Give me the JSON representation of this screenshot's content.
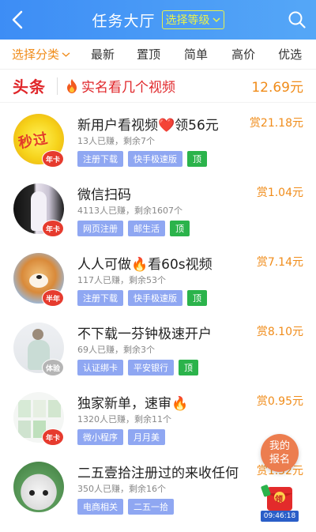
{
  "header": {
    "title": "任务大厅",
    "level_label": "选择等级"
  },
  "filters": [
    "选择分类",
    "最新",
    "置顶",
    "简单",
    "高价",
    "优选"
  ],
  "headline": {
    "logo": "头条",
    "text": "实名看几个视频",
    "amount": "12.69元"
  },
  "tasks": [
    {
      "name": "新用户看视频❤️领56元",
      "reward": "赏21.18元",
      "meta": "13人已赚，剩余7个",
      "badge": "年卡",
      "avatar_text": "秒过",
      "tags": [
        "注册下载",
        "快手极速版",
        "顶"
      ]
    },
    {
      "name": "微信扫码",
      "reward": "赏1.04元",
      "meta": "4113人已赚，剩余1607个",
      "badge": "年卡",
      "tags": [
        "网页注册",
        "邮生活",
        "顶"
      ]
    },
    {
      "name": "人人可做🔥看60s视频",
      "reward": "赏7.14元",
      "meta": "117人已赚，剩余53个",
      "badge": "半年",
      "tags": [
        "注册下载",
        "快手极速版",
        "顶"
      ]
    },
    {
      "name": "不下载一芬钟极速开户",
      "reward": "赏8.10元",
      "meta": "69人已赚，剩余3个",
      "badge": "体验",
      "tags": [
        "认证绑卡",
        "平安银行",
        "顶"
      ]
    },
    {
      "name": "独家新单，速审🔥",
      "reward": "赏0.95元",
      "meta": "1320人已赚，剩余11个",
      "badge": "年卡",
      "tags": [
        "微小程序",
        "月月美"
      ]
    },
    {
      "name": "二五壹拾注册过的来收任何",
      "reward": "赏1.32元",
      "meta": "350人已赚，剩余16个",
      "tags": [
        "电商相关",
        "二五一拾"
      ]
    }
  ],
  "float_button": "我的报名",
  "redpack": {
    "label": "领",
    "time": "09:46:18"
  },
  "colors": {
    "header": "#3d8df5",
    "accent": "#f08c1a",
    "headline": "#e0262a",
    "tag": "#8fa7f2",
    "top_tag": "#2bb34b"
  }
}
